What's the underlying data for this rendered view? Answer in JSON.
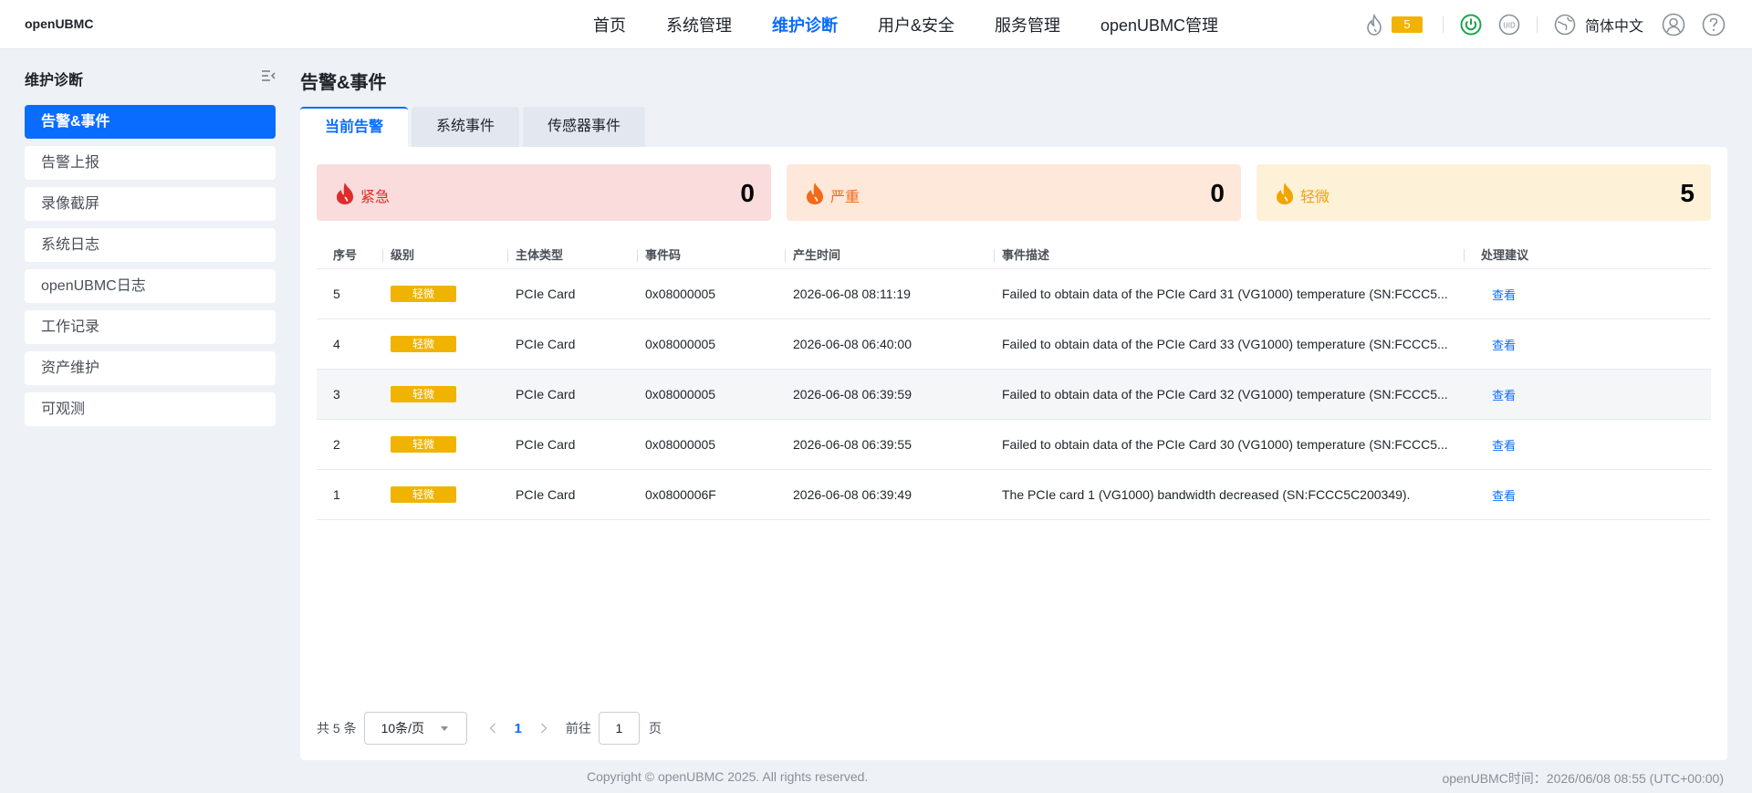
{
  "brand": "openUBMC",
  "nav": [
    "首页",
    "系统管理",
    "维护诊断",
    "用户&安全",
    "服务管理",
    "openUBMC管理"
  ],
  "nav_active": 2,
  "header": {
    "alarm_count": "5",
    "uid_label": "UID",
    "language": "简体中文"
  },
  "sidebar": {
    "title": "维护诊断",
    "items": [
      "告警&事件",
      "告警上报",
      "录像截屏",
      "系统日志",
      "openUBMC日志",
      "工作记录",
      "资产维护",
      "可观测"
    ],
    "active": 0
  },
  "page_title": "告警&事件",
  "tabs": [
    "当前告警",
    "系统事件",
    "传感器事件"
  ],
  "cards": {
    "urgent": {
      "label": "紧急",
      "value": "0"
    },
    "serious": {
      "label": "严重",
      "value": "0"
    },
    "minor": {
      "label": "轻微",
      "value": "5"
    }
  },
  "table": {
    "headers": [
      "序号",
      "级别",
      "主体类型",
      "事件码",
      "产生时间",
      "事件描述",
      "处理建议"
    ],
    "rows": [
      [
        "5",
        "轻微",
        "PCIe Card",
        "0x08000005",
        "2026-06-08 08:11:19",
        "Failed to obtain data of the PCIe Card 31 (VG1000) temperature (SN:FCCC5...",
        "查看"
      ],
      [
        "4",
        "轻微",
        "PCIe Card",
        "0x08000005",
        "2026-06-08 06:40:00",
        "Failed to obtain data of the PCIe Card 33 (VG1000) temperature (SN:FCCC5...",
        "查看"
      ],
      [
        "3",
        "轻微",
        "PCIe Card",
        "0x08000005",
        "2026-06-08 06:39:59",
        "Failed to obtain data of the PCIe Card 32 (VG1000) temperature (SN:FCCC5...",
        "查看"
      ],
      [
        "2",
        "轻微",
        "PCIe Card",
        "0x08000005",
        "2026-06-08 06:39:55",
        "Failed to obtain data of the PCIe Card 30 (VG1000) temperature (SN:FCCC5...",
        "查看"
      ],
      [
        "1",
        "轻微",
        "PCIe Card",
        "0x0800006F",
        "2026-06-08 06:39:49",
        "The PCIe card 1 (VG1000) bandwidth decreased (SN:FCCC5C200349).",
        "查看"
      ]
    ]
  },
  "pagination": {
    "total_text": "共 5 条",
    "page_size": "10条/页",
    "current_page": "1",
    "goto_label": "前往",
    "goto_value": "1",
    "page_unit": "页"
  },
  "footer": {
    "copyright": "Copyright © openUBMC 2025. All rights reserved.",
    "time": "openUBMC时间：2026/06/08 08:55 (UTC+00:00)"
  },
  "colors": {
    "accent": "#0a6cff",
    "minor": "#f0b400",
    "urgent": "#e02b2b",
    "serious": "#f26a1a"
  }
}
